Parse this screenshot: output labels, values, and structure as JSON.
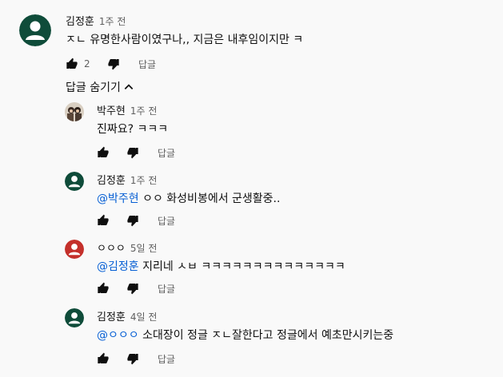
{
  "comment": {
    "author": "김정훈",
    "time": "1주 전",
    "text": "ㅈㄴ 유명한사람이였구나,, 지금은 내후임이지만 ㅋ",
    "likes": "2",
    "reply_label": "답글",
    "avatar_color": "#0f4c3a"
  },
  "hide_replies_label": "답글 숨기기",
  "replies": [
    {
      "author": "박주현",
      "time": "1주 전",
      "mention": "",
      "text": "진짜요? ㅋㅋㅋ",
      "reply_label": "답글",
      "avatar": "photo"
    },
    {
      "author": "김정훈",
      "time": "1주 전",
      "mention": "@박주현",
      "text": " ㅇㅇ 화성비봉에서 군생활중..",
      "reply_label": "답글",
      "avatar_color": "#0f4c3a"
    },
    {
      "author": "ㅇㅇㅇ",
      "time": "5일 전",
      "mention": "@김정훈",
      "text": " 지리네 ㅅㅂ ㅋㅋㅋㅋㅋㅋㅋㅋㅋㅋㅋㅋㅋㅋ",
      "reply_label": "답글",
      "avatar_color": "#c4302b"
    },
    {
      "author": "김정훈",
      "time": "4일 전",
      "mention": "@ㅇㅇㅇ",
      "text": " 소대장이 정글 ㅈㄴ잘한다고 정글에서 예초만시키는중",
      "reply_label": "답글",
      "avatar_color": "#0f4c3a"
    }
  ]
}
